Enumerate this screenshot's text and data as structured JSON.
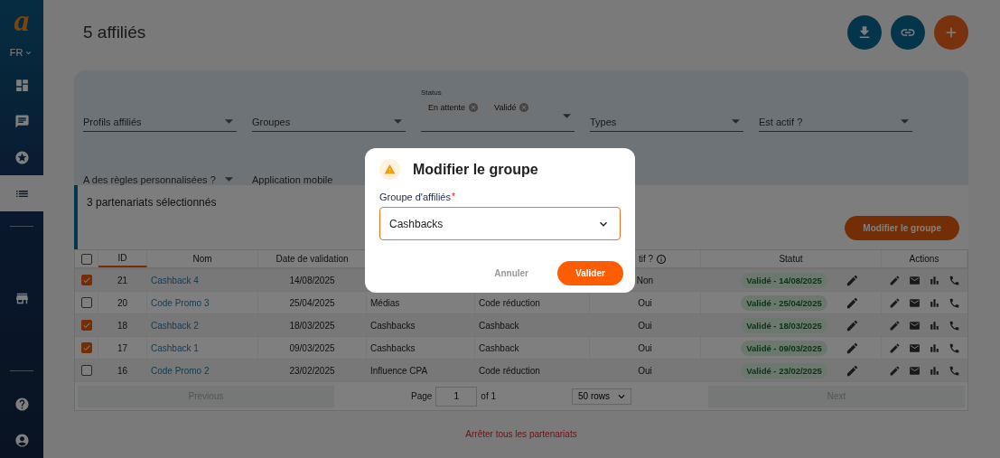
{
  "sidebar": {
    "logo": "a",
    "language": "FR",
    "nav": [
      {
        "kind": "dashboard",
        "selected": false
      },
      {
        "kind": "chat",
        "selected": false
      },
      {
        "kind": "star",
        "selected": false
      },
      {
        "kind": "list",
        "selected": true
      }
    ],
    "middle": [
      {
        "kind": "store",
        "selected": false
      }
    ],
    "bottom": [
      {
        "kind": "help",
        "selected": false
      },
      {
        "kind": "account",
        "selected": false
      }
    ]
  },
  "title": "5 affiliés",
  "actions": [
    {
      "kind": "download"
    },
    {
      "kind": "link"
    },
    {
      "kind": "add"
    }
  ],
  "filters": [
    {
      "kind": "select",
      "label": "Profils affiliés"
    },
    {
      "kind": "select",
      "label": "Groupes"
    },
    {
      "kind": "chips",
      "label": "Status",
      "chips": [
        "En attente",
        "Validé"
      ]
    },
    {
      "kind": "select",
      "label": "Types"
    },
    {
      "kind": "select",
      "label": "Est actif ?"
    },
    {
      "kind": "select",
      "label": "A des règles personnalisées ?"
    },
    {
      "kind": "text",
      "label": "Application mobile"
    }
  ],
  "selection": {
    "text": "3 partenariats sélectionnés",
    "button": "Modifier le groupe"
  },
  "table": {
    "header_checked": false,
    "columns": [
      {
        "label": "ID",
        "sorted": true
      },
      {
        "label": "Nom",
        "sorted": false
      },
      {
        "label": "Date de validation",
        "sorted": false
      },
      {
        "label": "tif ?",
        "info": true,
        "sorted": false
      },
      {
        "label": "Statut",
        "sorted": false
      },
      {
        "label": "Actions",
        "sorted": false
      }
    ],
    "rows": [
      {
        "checked": true,
        "id": "21",
        "name": "Cashback 4",
        "date": "14/08/2025",
        "active": "Non",
        "status": "Validé - 14/08/2025"
      },
      {
        "checked": false,
        "id": "20",
        "name": "Code Promo 3",
        "date": "25/04/2025",
        "group": "Médias",
        "type": "Code réduction",
        "active": "Oui",
        "status": "Validé - 25/04/2025"
      },
      {
        "checked": true,
        "id": "18",
        "name": "Cashback 2",
        "date": "18/03/2025",
        "group": "Cashbacks",
        "type": "Cashback",
        "active": "Oui",
        "status": "Validé - 18/03/2025"
      },
      {
        "checked": true,
        "id": "17",
        "name": "Cashback 1",
        "date": "09/03/2025",
        "group": "Cashbacks",
        "type": "Cashback",
        "active": "Oui",
        "status": "Validé - 09/03/2025"
      },
      {
        "checked": false,
        "id": "16",
        "name": "Code Promo 2",
        "date": "23/02/2025",
        "group": "Influence CPA",
        "type": "Code réduction",
        "active": "Oui",
        "status": "Validé - 23/02/2025"
      }
    ]
  },
  "pagination": {
    "previous": {
      "label": "Previous",
      "disabled": true
    },
    "page_label": "Page",
    "page": "1",
    "of": "of 1",
    "rows_option": "50 rows",
    "next": {
      "label": "Next",
      "disabled": true
    }
  },
  "footer_link": "Arrêter tous les partenariats",
  "modal": {
    "title": "Modifier le groupe",
    "field_label": "Groupe d'affiliés",
    "required_mark": "*",
    "value": "Cashbacks",
    "cancel": "Annuler",
    "confirm": "Valider"
  }
}
